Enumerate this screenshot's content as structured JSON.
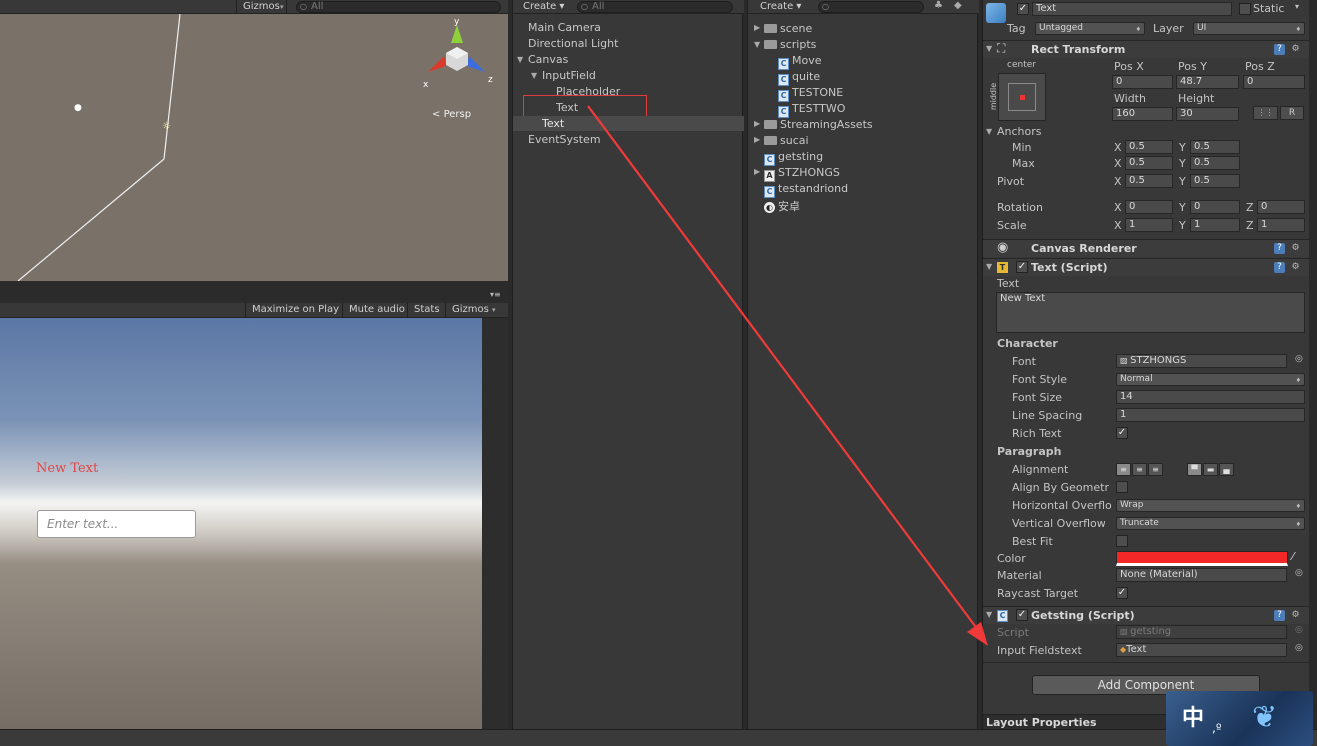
{
  "scene": {
    "gizmos_label": "Gizmos",
    "search_placeholder": "All",
    "persp_label": "Persp",
    "axis_y": "y",
    "axis_x": "x",
    "axis_z": "z"
  },
  "game": {
    "toolbar": [
      "Maximize on Play",
      "Mute audio",
      "Stats",
      "Gizmos"
    ],
    "new_text": "New Text",
    "input_placeholder": "Enter text..."
  },
  "hierarchy": {
    "create_label": "Create",
    "search_placeholder": "All",
    "items": [
      {
        "label": "Main Camera"
      },
      {
        "label": "Directional Light"
      },
      {
        "label": "Canvas"
      },
      {
        "label": "InputField"
      },
      {
        "label": "Placeholder"
      },
      {
        "label": "Text"
      },
      {
        "label": "Text"
      },
      {
        "label": "EventSystem"
      }
    ]
  },
  "project": {
    "create_label": "Create",
    "items": [
      {
        "label": "scene",
        "kind": "folder"
      },
      {
        "label": "scripts",
        "kind": "folder"
      },
      {
        "label": "Move",
        "kind": "script"
      },
      {
        "label": "quite",
        "kind": "script"
      },
      {
        "label": "TESTONE",
        "kind": "script"
      },
      {
        "label": "TESTTWO",
        "kind": "script"
      },
      {
        "label": "StreamingAssets",
        "kind": "folder"
      },
      {
        "label": "sucai",
        "kind": "folder"
      },
      {
        "label": "getsting",
        "kind": "script"
      },
      {
        "label": "STZHONGS",
        "kind": "font"
      },
      {
        "label": "testandriond",
        "kind": "script"
      },
      {
        "label": "安卓",
        "kind": "unity"
      }
    ]
  },
  "inspector": {
    "object_name": "Text",
    "static_label": "Static",
    "tag_label": "Tag",
    "tag_value": "Untagged",
    "layer_label": "Layer",
    "layer_value": "UI",
    "rect": {
      "title": "Rect Transform",
      "anchor_h": "center",
      "anchor_v": "middle",
      "posx_label": "Pos X",
      "posx": "0",
      "posy_label": "Pos Y",
      "posy": "48.7",
      "posz_label": "Pos Z",
      "posz": "0",
      "width_label": "Width",
      "width": "160",
      "height_label": "Height",
      "height": "30",
      "r_button": "R",
      "anchors_label": "Anchors",
      "min_label": "Min",
      "min_x": "0.5",
      "min_y": "0.5",
      "max_label": "Max",
      "max_x": "0.5",
      "max_y": "0.5",
      "pivot_label": "Pivot",
      "pivot_x": "0.5",
      "pivot_y": "0.5",
      "rotation_label": "Rotation",
      "rot_x": "0",
      "rot_y": "0",
      "rot_z": "0",
      "scale_label": "Scale",
      "scale_x": "1",
      "scale_y": "1",
      "scale_z": "1",
      "x": "X",
      "y": "Y",
      "z": "Z"
    },
    "canvas_renderer": {
      "title": "Canvas Renderer"
    },
    "text_script": {
      "title": "Text (Script)",
      "text_label": "Text",
      "text_value": "New Text",
      "character_label": "Character",
      "font_label": "Font",
      "font_value": "STZHONGS",
      "font_style_label": "Font Style",
      "font_style_value": "Normal",
      "font_size_label": "Font Size",
      "font_size_value": "14",
      "line_spacing_label": "Line Spacing",
      "line_spacing_value": "1",
      "rich_text_label": "Rich Text",
      "paragraph_label": "Paragraph",
      "alignment_label": "Alignment",
      "align_geometry_label": "Align By Geometr",
      "hoverflow_label": "Horizontal Overflo",
      "hoverflow_value": "Wrap",
      "voverflow_label": "Vertical Overflow",
      "voverflow_value": "Truncate",
      "best_fit_label": "Best Fit",
      "color_label": "Color",
      "color_value": "#f22828",
      "material_label": "Material",
      "material_value": "None (Material)",
      "raycast_label": "Raycast Target"
    },
    "getsting": {
      "title": "Getsting (Script)",
      "script_label": "Script",
      "script_value": "getsting",
      "input_label": "Input Fieldstext",
      "input_value": "Text"
    },
    "add_component": "Add Component",
    "layout_properties": "Layout Properties"
  },
  "watermark": {
    "char": "中"
  },
  "colors": {
    "selection_box": "#e23b3b",
    "arrow": "#f03a3a",
    "new_text": "#e24646"
  }
}
